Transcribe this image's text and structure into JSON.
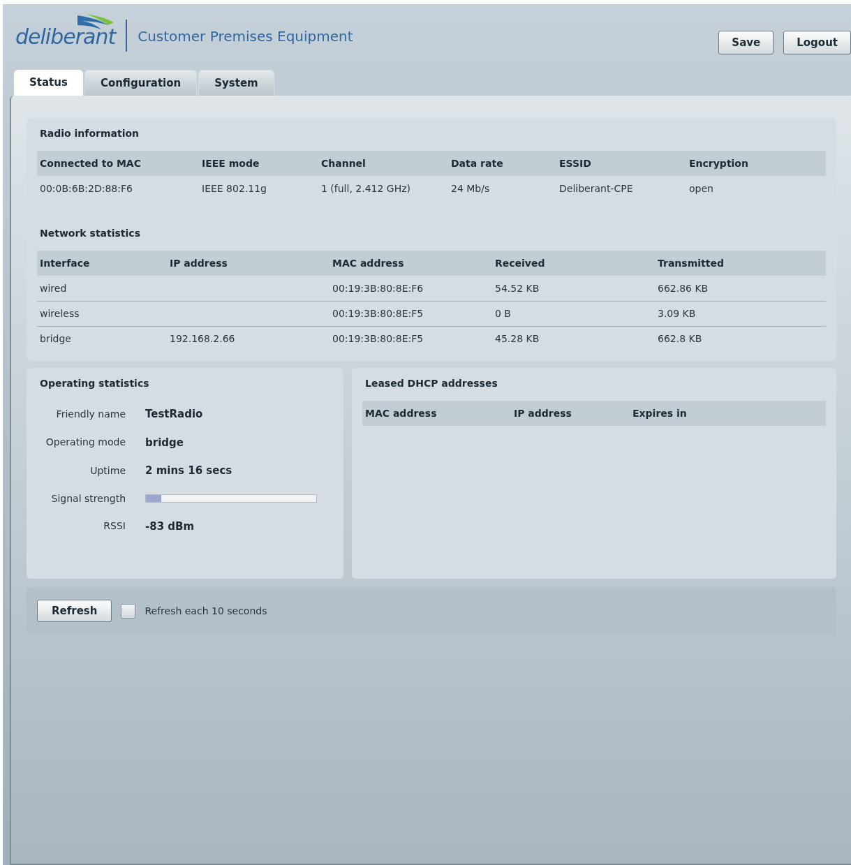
{
  "header": {
    "logo": "deliberant",
    "title": "Customer Premises Equipment",
    "buttons": [
      "Save",
      "Logout"
    ]
  },
  "tabs": [
    {
      "label": "Status",
      "selected": true
    },
    {
      "label": "Configuration",
      "selected": false
    },
    {
      "label": "System",
      "selected": false
    }
  ],
  "radio_information": {
    "title": "Radio information",
    "columns": [
      "Connected to MAC",
      "IEEE mode",
      "Channel",
      "Data rate",
      "ESSID",
      "Encryption"
    ],
    "rows": [
      [
        "00:0B:6B:2D:88:F6",
        "IEEE 802.11g",
        "1 (full, 2.412 GHz)",
        "24 Mb/s",
        "Deliberant-CPE",
        "open"
      ]
    ]
  },
  "network_statistics": {
    "title": "Network statistics",
    "columns": [
      "Interface",
      "IP address",
      "MAC address",
      "Received",
      "Transmitted"
    ],
    "rows": [
      [
        "wired",
        "",
        "00:19:3B:80:8E:F6",
        "54.52 KB",
        "662.86 KB"
      ],
      [
        "wireless",
        "",
        "00:19:3B:80:8E:F5",
        "0 B",
        "3.09 KB"
      ],
      [
        "bridge",
        "192.168.2.66",
        "00:19:3B:80:8E:F5",
        "45.28 KB",
        "662.8 KB"
      ]
    ]
  },
  "operating_statistics": {
    "title": "Operating statistics",
    "fields": [
      {
        "kind": "text",
        "label": "Friendly name",
        "value": "TestRadio"
      },
      {
        "kind": "text",
        "label": "Operating mode",
        "value": "bridge"
      },
      {
        "kind": "text",
        "label": "Uptime",
        "value": "2 mins 16 secs"
      },
      {
        "kind": "meter",
        "label": "Signal strength",
        "level": 0.09
      },
      {
        "kind": "text",
        "label": "RSSI",
        "value": "-83 dBm"
      }
    ]
  },
  "leased_dhcp_addresses": {
    "title": "Leased DHCP addresses",
    "columns": [
      "MAC address",
      "IP address",
      "Expires in"
    ]
  },
  "footer": {
    "button": "Refresh",
    "auto_refresh": {
      "label": "Refresh each 10 seconds",
      "checked": false
    }
  }
}
